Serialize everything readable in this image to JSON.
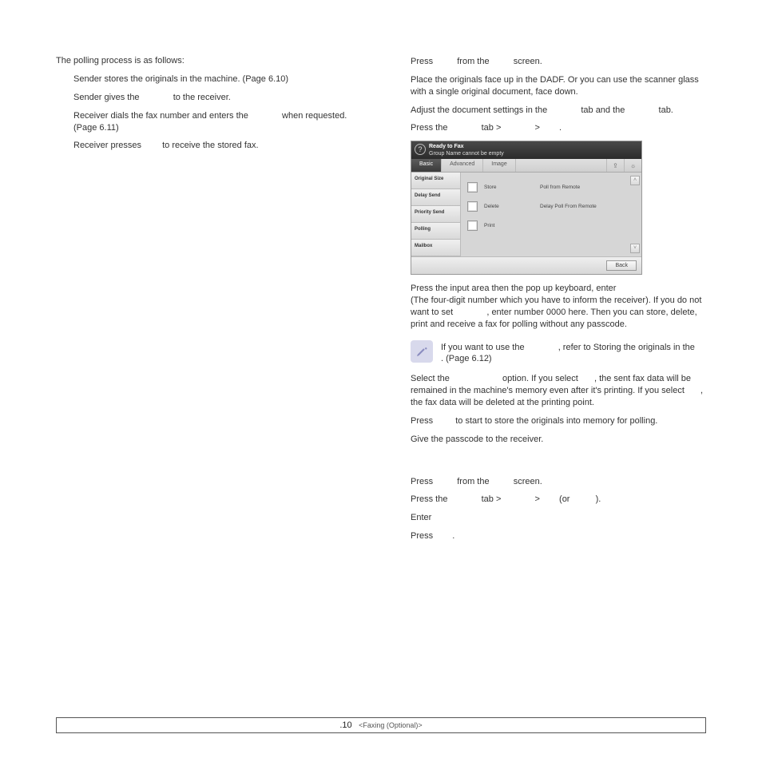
{
  "intro": "The polling process is as follows:",
  "left": {
    "s1a": "Sender stores the originals in the machine. (Page 6.10)",
    "s2a": "Sender gives the ",
    "s2b": " to the receiver.",
    "s3a": "Receiver dials the fax number and enters the ",
    "s3b": " when requested. (Page 6.11)",
    "s4a": "Receiver presses ",
    "s4b": " to receive the stored fax."
  },
  "right": {
    "r1a": "Press ",
    "r1b": " from the ",
    "r1c": " screen.",
    "r2": "Place the originals face up in the DADF. Or you can use the scanner glass with a single original document, face down.",
    "r3a": "Adjust the document settings in the ",
    "r3b": " tab and the ",
    "r3c": " tab.",
    "r4a": "Press the ",
    "r4b": " tab > ",
    "r4c": " > ",
    "r4d": " .",
    "input1a": "Press the input area then the pop up keyboard, enter",
    "input1b": "(The four-digit number which you have to inform the receiver). If you do not want to set ",
    "input1c": ", enter number 0000 here. Then you can store, delete, print and receive a fax for polling without any passcode.",
    "note_a": "If you want to use the ",
    "note_b": ", refer to Storing the originals in the ",
    "note_c": ". (Page 6.12)",
    "sel_a": "Select the ",
    "sel_b": " option. If you select ",
    "sel_c": ", the sent fax data will be remained in the machine's memory even after it's printing. If you select ",
    "sel_d": ", the fax data will be deleted at the printing point.",
    "store_a": "Press ",
    "store_b": " to start to store the originals into memory for polling.",
    "give": "Give the passcode to the receiver.",
    "b1a": "Press ",
    "b1b": " from the ",
    "b1c": " screen.",
    "b2a": "Press the ",
    "b2b": " tab > ",
    "b2c": " > ",
    "b2d": " (or ",
    "b2e": " ).",
    "b3": "Enter",
    "b4a": "Press ",
    "b4b": " ."
  },
  "device": {
    "head1": "Ready to Fax",
    "head2": "Group Name cannot be empty",
    "tabs": {
      "basic": "Basic",
      "advanced": "Advanced",
      "image": "Image"
    },
    "side": [
      "Original Size",
      "Delay Send",
      "Priority Send",
      "Polling",
      "Mailbox"
    ],
    "opts": {
      "store": "Store",
      "poll": "Poll from Remote",
      "delete": "Delete",
      "delay": "Delay Poll From Remote",
      "print": "Print"
    },
    "back": "Back"
  },
  "footer": {
    "page": ".10",
    "section": "<Faxing (Optional)>"
  }
}
